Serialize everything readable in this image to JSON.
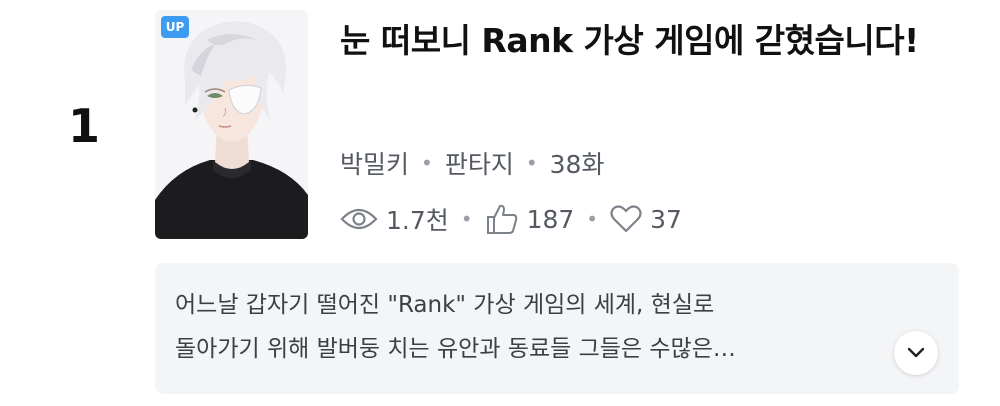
{
  "rank": "1",
  "cover": {
    "badge": "UP",
    "badge_color": "#3d9cf2"
  },
  "title": "눈 떠보니 Rank 가상 게임에 갇혔습니다!",
  "meta": {
    "author": "박밀키",
    "genre": "판타지",
    "episodes": "38화"
  },
  "stats": {
    "views": "1.7천",
    "likes": "187",
    "favorites": "37",
    "icons": [
      "eye-icon",
      "thumbs-up-icon",
      "heart-icon"
    ]
  },
  "synopsis": {
    "line1": "어느날 갑자기 떨어진 \"Rank\" 가상 게임의 세계, 현실로",
    "line2": "돌아가기 위해 발버둥 치는 유안과 동료들 그들은 수많은…",
    "expand_icon": "chevron-down-icon"
  }
}
